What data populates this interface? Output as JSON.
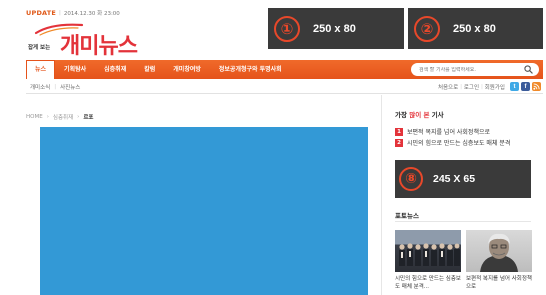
{
  "header": {
    "update_label": "UPDATE",
    "datetime": "2014.12.30 화 23:00",
    "logo_small": "잡게 보는",
    "logo_main": "개미뉴스"
  },
  "ads": {
    "top1": {
      "number": "①",
      "size": "250 x 80"
    },
    "top2": {
      "number": "②",
      "size": "250 x 80"
    },
    "side": {
      "number": "⑧",
      "size": "245 X 65"
    }
  },
  "nav": {
    "items": [
      "뉴스",
      "기획탐사",
      "심층취재",
      "칼럼",
      "개미창여방",
      "정보공개청구와 투명사회"
    ],
    "search_placeholder": "검색 할 기사를 입력하세요."
  },
  "subnav": {
    "items": [
      "개미소식",
      "사진뉴스"
    ],
    "util": [
      "처음으로",
      "로그인",
      "회원가입"
    ]
  },
  "breadcrumb": [
    "HOME",
    "심층취재",
    "르포"
  ],
  "sidebar": {
    "popular_title_pre": "가장 ",
    "popular_title_hl": "많이 본",
    "popular_title_post": " 기사",
    "popular": [
      {
        "rank": "1",
        "title": "보편적 복지를 넘어 사회정책으로"
      },
      {
        "rank": "2",
        "title": "시민의 힘으로 만드는 심층보도 매체 분격"
      }
    ],
    "photo_title": "포토뉴스",
    "photos": [
      {
        "caption": "시민의 힘으로 만드는 심층보도 매체 분격..."
      },
      {
        "caption": "보편적 복지를 넘어 사회정책으로"
      }
    ]
  },
  "colors": {
    "brand_red": "#e3333a",
    "nav_orange": "#e5531b",
    "ad_dark": "#3a3a3a",
    "image_blue": "#3399d6"
  }
}
